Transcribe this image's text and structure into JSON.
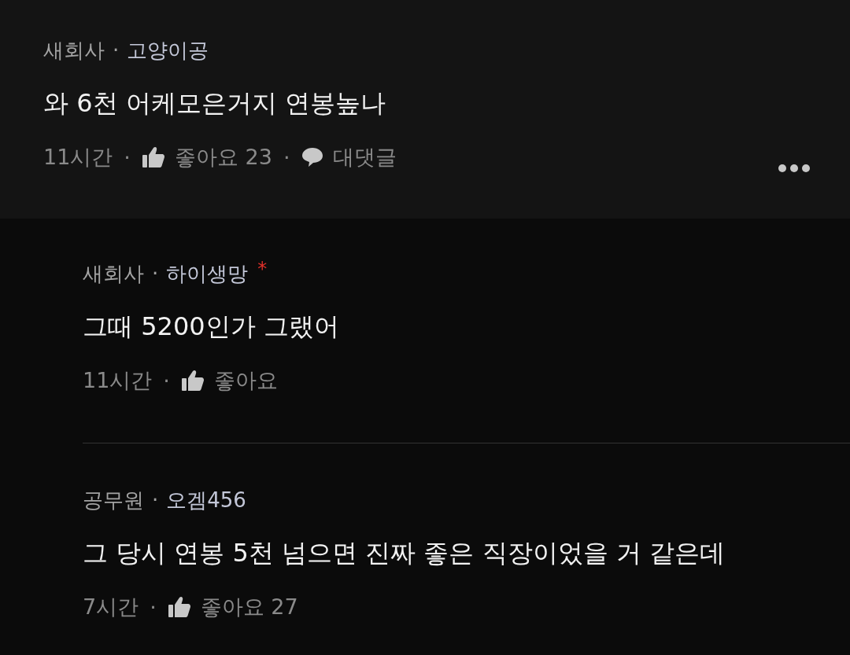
{
  "comment": {
    "header": [
      {
        "kind": "company",
        "text": "새회사"
      },
      {
        "kind": "dot",
        "text": "·"
      },
      {
        "kind": "nickname",
        "text": "고양이공"
      }
    ],
    "text": "와 6천 어케모은거지 연봉높나",
    "meta": [
      {
        "kind": "time",
        "text": "11시간"
      },
      {
        "kind": "dot",
        "text": "·"
      },
      {
        "kind": "like",
        "text": "좋아요 23"
      },
      {
        "kind": "dot",
        "text": "·"
      },
      {
        "kind": "reply",
        "text": "대댓글"
      }
    ],
    "more_menu": true
  },
  "replies": [
    {
      "header": [
        {
          "kind": "company",
          "text": "새회사"
        },
        {
          "kind": "dot",
          "text": "·"
        },
        {
          "kind": "nickname",
          "text": "하이생망"
        },
        {
          "kind": "mark",
          "text": "*"
        }
      ],
      "text": "그때 5200인가 그랬어",
      "meta": [
        {
          "kind": "time",
          "text": "11시간"
        },
        {
          "kind": "dot",
          "text": "·"
        },
        {
          "kind": "like",
          "text": "좋아요"
        }
      ]
    },
    {
      "header": [
        {
          "kind": "company",
          "text": "공무원"
        },
        {
          "kind": "dot",
          "text": "·"
        },
        {
          "kind": "nickname",
          "text": "오겜456"
        }
      ],
      "text": "그 당시 연봉 5천 넘으면 진짜 좋은 직장이었을 거 같은데",
      "meta": [
        {
          "kind": "time",
          "text": "7시간"
        },
        {
          "kind": "dot",
          "text": "·"
        },
        {
          "kind": "like",
          "text": "좋아요 27"
        }
      ]
    }
  ]
}
